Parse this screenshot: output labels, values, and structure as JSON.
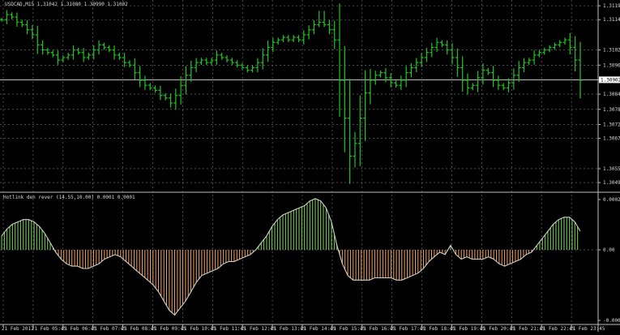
{
  "symbol_header": "USDCAD,M15  1.31042 1.31080 1.30990 1.31002",
  "oscillator_header": "Hotlink den rever (14.55,10.00) 0.0001 0.0001",
  "colors": {
    "background": "#000000",
    "grid": "#7a7a7a",
    "candle": "#21c421",
    "hist_pos": "#7ed957",
    "hist_neg": "#f2a35a",
    "osc_line": "#cfcfcf",
    "price_line": "#c8c8c8"
  },
  "price_axis": {
    "labels": [
      "1.31195",
      "1.31140",
      "1.31020",
      "1.30960",
      "1.30902",
      "1.30845",
      "1.30785",
      "1.30725",
      "1.30670",
      "1.30550",
      "1.30495"
    ],
    "current_price": "1.30902"
  },
  "osc_axis": {
    "labels": [
      "0.0002",
      "0.00",
      "-0.0003"
    ]
  },
  "time_axis": {
    "labels": [
      "21 Feb 2017",
      "21 Feb 05:45",
      "21 Feb 06:45",
      "21 Feb 07:45",
      "21 Feb 08:45",
      "21 Feb 09:45",
      "21 Feb 10:45",
      "21 Feb 11:45",
      "21 Feb 12:45",
      "21 Feb 13:45",
      "21 Feb 14:45",
      "21 Feb 15:45",
      "21 Feb 16:45",
      "21 Feb 17:45",
      "21 Feb 18:45",
      "21 Feb 19:45",
      "21 Feb 20:45",
      "21 Feb 21:45",
      "21 Feb 22:45",
      "21 Feb 23:45"
    ]
  },
  "chart_data": {
    "type": "line",
    "ylim": [
      1.3046,
      1.31205
    ],
    "osc_ylim": [
      -0.00031,
      0.00023
    ],
    "price_series": [
      1.3114,
      1.3116,
      1.3115,
      1.3113,
      1.3112,
      1.311,
      1.3108,
      1.3104,
      1.3102,
      1.3101,
      1.31,
      1.3098,
      1.3099,
      1.31,
      1.3102,
      1.3101,
      1.3099,
      1.31,
      1.3102,
      1.3104,
      1.3103,
      1.3102,
      1.31,
      1.3099,
      1.3097,
      1.3096,
      1.3093,
      1.309,
      1.3088,
      1.3087,
      1.3086,
      1.3084,
      1.3083,
      1.3081,
      1.3084,
      1.3088,
      1.3092,
      1.3095,
      1.3097,
      1.3098,
      1.3097,
      1.3098,
      1.31,
      1.3099,
      1.3098,
      1.3097,
      1.3096,
      1.3095,
      1.3094,
      1.3095,
      1.3097,
      1.31,
      1.3103,
      1.3105,
      1.3106,
      1.3107,
      1.3106,
      1.3107,
      1.3106,
      1.3108,
      1.311,
      1.3112,
      1.3113,
      1.3112,
      1.311,
      1.3106,
      1.309,
      1.3075,
      1.306,
      1.3065,
      1.3075,
      1.3085,
      1.309,
      1.3092,
      1.3093,
      1.3091,
      1.3089,
      1.3088,
      1.309,
      1.3093,
      1.3095,
      1.3097,
      1.3099,
      1.3101,
      1.3103,
      1.3105,
      1.3104,
      1.3102,
      1.3099,
      1.3095,
      1.309,
      1.3087,
      1.3088,
      1.3091,
      1.3094,
      1.3093,
      1.309,
      1.3088,
      1.3087,
      1.3089,
      1.3092,
      1.3095,
      1.3097,
      1.3098,
      1.31,
      1.3101,
      1.3102,
      1.3103,
      1.3104,
      1.3105,
      1.3106,
      1.3103,
      1.3098,
      1.309
    ],
    "osc_series": [
      6e-05,
      9e-05,
      0.00011,
      0.00012,
      0.00013,
      0.00013,
      0.00012,
      0.0001,
      7e-05,
      3e-05,
      -1e-05,
      -4e-05,
      -6e-05,
      -7e-05,
      -7e-05,
      -8e-05,
      -8e-05,
      -7e-05,
      -6e-05,
      -4e-05,
      -3e-05,
      -2e-05,
      -3e-05,
      -5e-05,
      -7e-05,
      -9e-05,
      -0.00011,
      -0.00013,
      -0.00015,
      -0.00018,
      -0.00022,
      -0.00026,
      -0.00028,
      -0.00025,
      -0.00022,
      -0.00018,
      -0.00014,
      -0.00011,
      -0.0001,
      -9e-05,
      -8e-05,
      -6e-05,
      -5e-05,
      -5e-05,
      -4e-05,
      -3e-05,
      -2e-05,
      0.0,
      3e-05,
      6e-05,
      0.0001,
      0.00013,
      0.00015,
      0.00016,
      0.00017,
      0.00018,
      0.00019,
      0.00021,
      0.00022,
      0.00021,
      0.00018,
      0.00012,
      2e-05,
      -6e-05,
      -0.00011,
      -0.00013,
      -0.00013,
      -0.00013,
      -0.00013,
      -0.00012,
      -0.00012,
      -0.00012,
      -0.00012,
      -0.00013,
      -0.00013,
      -0.00012,
      -0.00011,
      -0.0001,
      -8e-05,
      -5e-05,
      -3e-05,
      -1e-05,
      -2e-05,
      2e-05,
      -2e-05,
      -4e-05,
      -3e-05,
      -4e-05,
      -4e-05,
      -4e-05,
      -3e-05,
      -4e-05,
      -6e-05,
      -7e-05,
      -6e-05,
      -5e-05,
      -4e-05,
      -2e-05,
      -1e-05,
      2e-05,
      5e-05,
      8e-05,
      0.00011,
      0.00013,
      0.00014,
      0.00014,
      0.00012,
      8e-05
    ]
  }
}
